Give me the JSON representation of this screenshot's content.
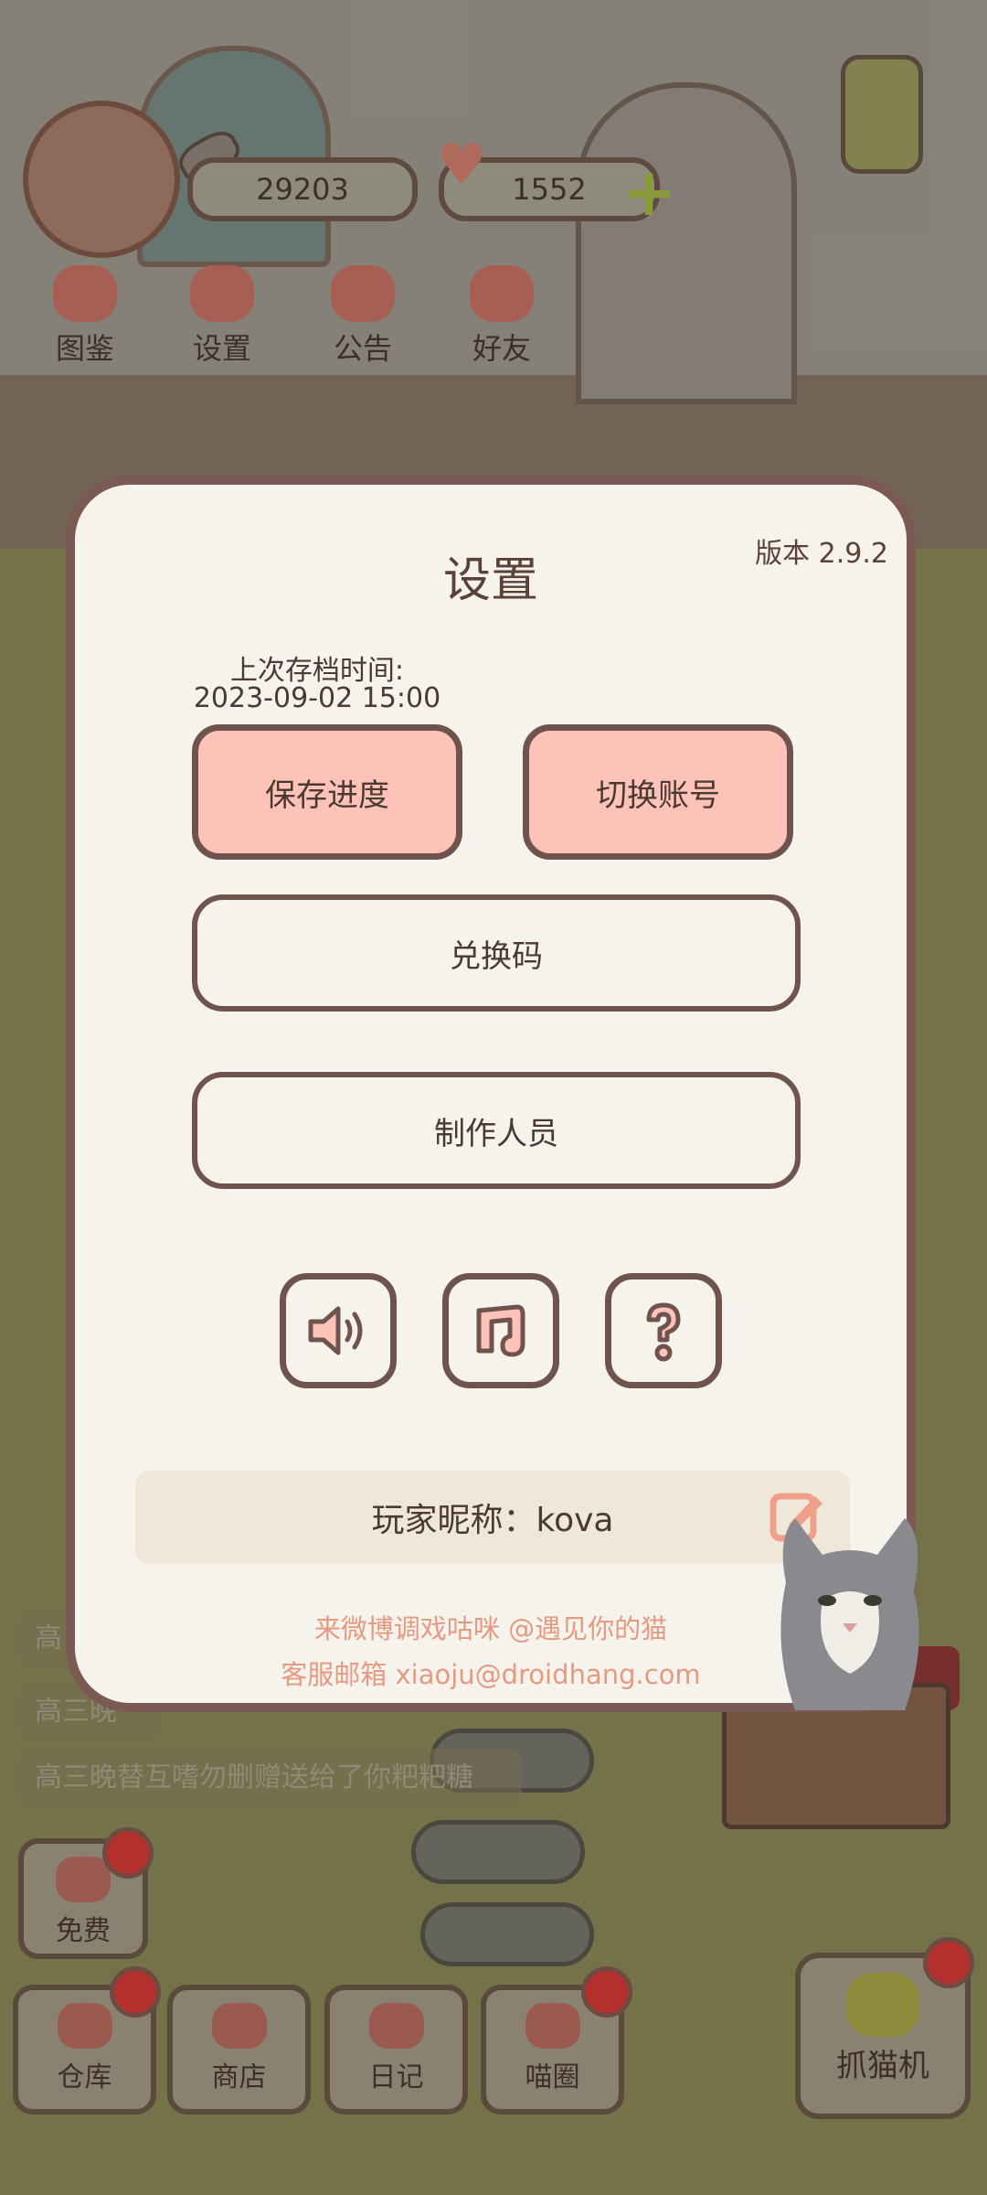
{
  "hud": {
    "fish_count": "29203",
    "heart_count": "1552",
    "menu": [
      {
        "label": "图鉴",
        "icon": "cat-face-icon"
      },
      {
        "label": "设置",
        "icon": "gear-icon"
      },
      {
        "label": "公告",
        "icon": "gift-icon"
      },
      {
        "label": "好友",
        "icon": "friends-icon"
      }
    ]
  },
  "chat": {
    "line1": "高",
    "line2": "高三晚",
    "line3": "高三晚替互嗜勿删赠送给了你粑粑糖"
  },
  "bottom_bar": {
    "free_label": "免费",
    "warehouse_label": "仓库",
    "shop_label": "商店",
    "diary_label": "日记",
    "meow_circle_label": "喵圈",
    "claw_machine_label": "抓猫机"
  },
  "settings": {
    "title": "设置",
    "version": "版本 2.9.2",
    "last_save_label": "上次存档时间:",
    "last_save_time": "2023-09-02 15:00",
    "save_button": "保存进度",
    "switch_account_button": "切换账号",
    "redeem_code_button": "兑换码",
    "credits_button": "制作人员",
    "nickname_text": "玩家昵称：kova",
    "footer_weibo": "来微博调戏咕咪 @遇见你的猫",
    "footer_email": "客服邮箱 xiaoju@droidhang.com"
  },
  "colors": {
    "modal_bg": "#f6f2ec",
    "modal_border": "#7a5a52",
    "pink_button": "#fec3b8",
    "footer_text": "#e59a82"
  }
}
